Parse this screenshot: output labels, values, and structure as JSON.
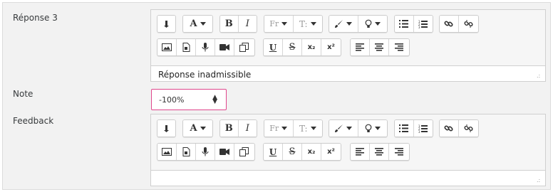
{
  "labels": {
    "answer3": "Réponse 3",
    "grade": "Note",
    "feedback": "Feedback"
  },
  "answer3_editor": {
    "content": "Réponse inadmissible"
  },
  "feedback_editor": {
    "content": ""
  },
  "grade_select": {
    "value": "-100%"
  },
  "toolbar": {
    "collapse_icon": "toolbar-collapse-icon",
    "font_color_icon": "font-color-icon",
    "bold": "B",
    "italic": "I",
    "font_family_icon": "font-family-icon",
    "font_size_icon": "font-size-icon",
    "text_style_icon": "paintbrush-icon",
    "tips_icon": "lightbulb-icon",
    "unordered_list_icon": "unordered-list-icon",
    "ordered_list_icon": "ordered-list-icon",
    "link_icon": "link-icon",
    "unlink_icon": "unlink-icon",
    "image_icon": "image-icon",
    "media_icon": "media-icon",
    "record_audio_icon": "microphone-icon",
    "record_video_icon": "video-camera-icon",
    "manage_files_icon": "copy-files-icon",
    "underline": "U",
    "strike": "S",
    "subscript": "x₂",
    "superscript": "x²",
    "align_left_icon": "align-left-icon",
    "align_center_icon": "align-center-icon",
    "align_right_icon": "align-right-icon"
  },
  "colors": {
    "panel_bg": "#f2f2f2",
    "focus_border": "#e0468c"
  }
}
